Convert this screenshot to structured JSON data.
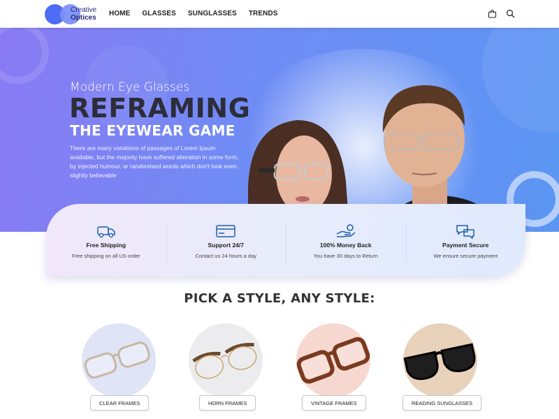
{
  "brand": {
    "line1": "Creative",
    "line2": "Optices"
  },
  "nav": [
    "HOME",
    "GLASSES",
    "SUNGLASSES",
    "TRENDS"
  ],
  "icons": {
    "cart": "shopping-bag-icon",
    "search": "search-icon"
  },
  "hero": {
    "subtitle": "Modern Eye Glasses",
    "title": "REFRAMING",
    "title2": "THE EYEWEAR GAME",
    "paragraph": "There are many variations of passages of Lorem Ipsum available, but the majority have suffered alteration in some form, by injected humour, or randomised words which don't look even slightly believable"
  },
  "features": [
    {
      "icon": "delivery-truck-icon",
      "title": "Free Shipping",
      "desc": "Free shipping on all US order"
    },
    {
      "icon": "credit-card-icon",
      "title": "Support 24/7",
      "desc": "Contact us 24 hours a day"
    },
    {
      "icon": "money-hand-icon",
      "title": "100% Money Back",
      "desc": "You have 30 days to Return"
    },
    {
      "icon": "chat-bubbles-icon",
      "title": "Payment Secure",
      "desc": "We ensure secure payment"
    }
  ],
  "section_title": "PICK A STYLE, ANY STYLE:",
  "styles": [
    {
      "label": "CLEAR FRAMES",
      "bg": "#dfe4f6"
    },
    {
      "label": "HORN FRAMES",
      "bg": "#ececef"
    },
    {
      "label": "VINTAGE FRAMES",
      "bg": "#f7d8d0"
    },
    {
      "label": "READING SUNGLASSES",
      "bg": "#e9d2bb"
    }
  ],
  "colors": {
    "accent": "#4f6cf5",
    "hero_start": "#8a7af3",
    "hero_end": "#5b96f3",
    "title_dark": "#2d2d3a"
  }
}
